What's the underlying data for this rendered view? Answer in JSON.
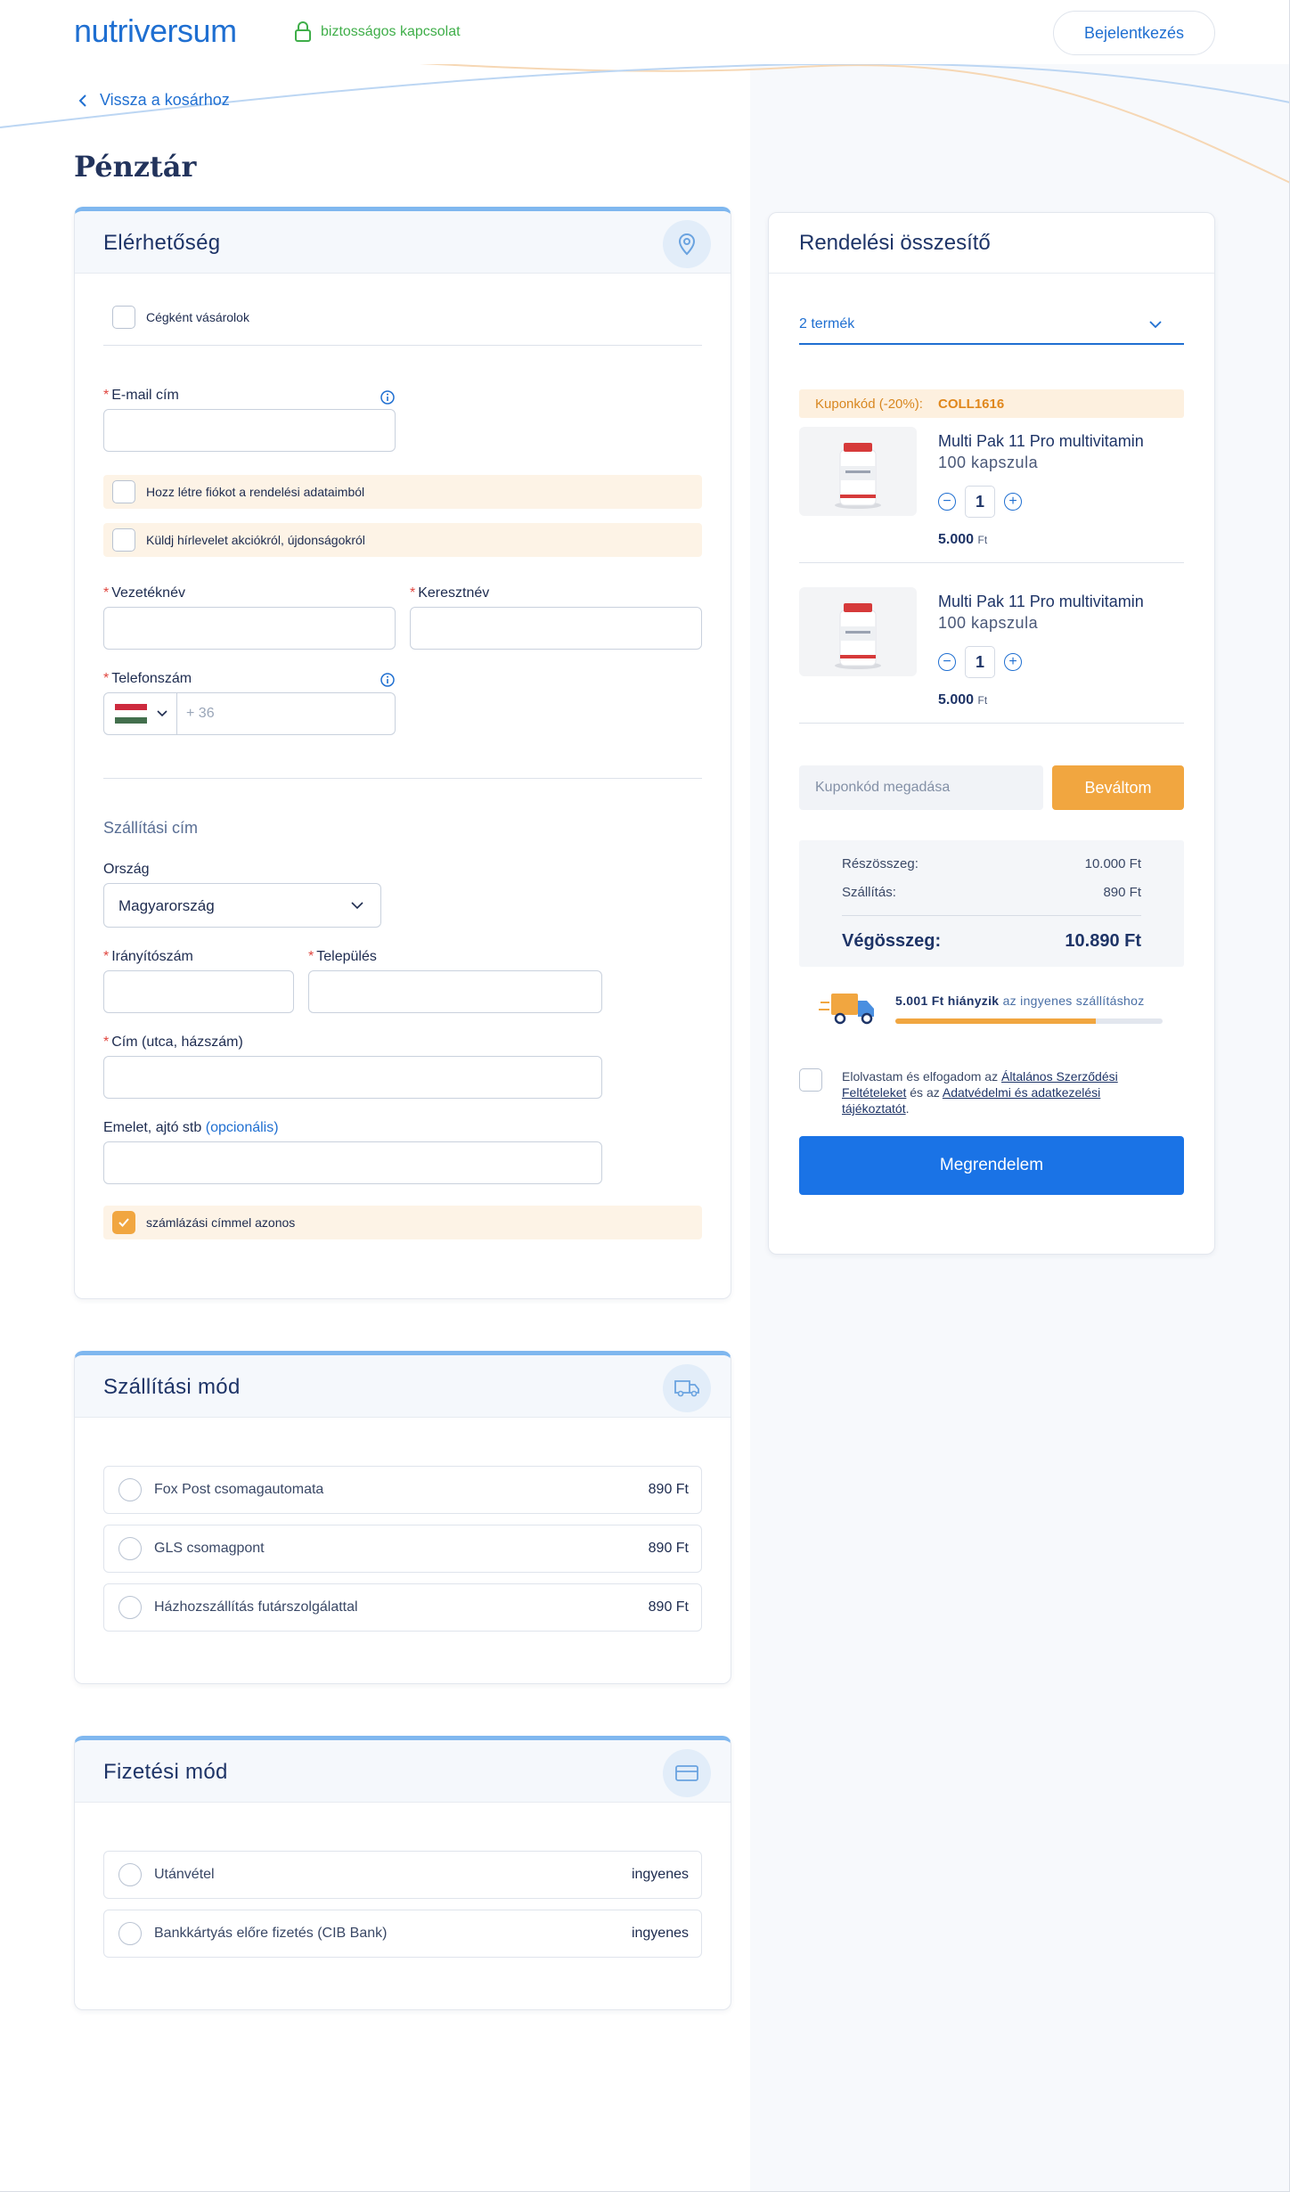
{
  "header": {
    "logo": "nutriversum",
    "secure_text": "biztosságos kapcsolat",
    "login_label": "Bejelentkezés"
  },
  "nav": {
    "back_label": "Vissza a kosárhoz"
  },
  "page_title": "Pénztár",
  "contact": {
    "title": "Elérhetőség",
    "company_checkbox": "Cégként vásárolok",
    "email_label": "E-mail cím",
    "create_account": "Hozz létre fiókot a rendelési adataimból",
    "newsletter": "Küldj hírlevelet akciókról, újdonságokról",
    "lastname_label": "Vezetéknév",
    "firstname_label": "Keresztnév",
    "phone_label": "Telefonszám",
    "phone_placeholder": "+ 36",
    "shipping_title": "Szállítási cím",
    "country_label": "Ország",
    "country_value": "Magyarország",
    "zip_label": "Irányítószám",
    "city_label": "Település",
    "address_label": "Cím (utca, házszám)",
    "floor_label": "Emelet, ajtó stb",
    "floor_optional": "(opcionális)",
    "same_billing": "számlázási címmel azonos"
  },
  "shipping": {
    "title": "Szállítási mód",
    "options": [
      {
        "label": "Fox Post csomagautomata",
        "price": "890 Ft"
      },
      {
        "label": "GLS csomagpont",
        "price": "890 Ft"
      },
      {
        "label": "Házhozszállítás futárszolgálattal",
        "price": "890 Ft"
      }
    ]
  },
  "payment": {
    "title": "Fizetési mód",
    "options": [
      {
        "label": "Utánvétel",
        "price": "ingyenes"
      },
      {
        "label": "Bankkártyás előre fizetés (CIB Bank)",
        "price": "ingyenes"
      }
    ]
  },
  "summary": {
    "title": "Rendelési összesítő",
    "items_count": "2 termék",
    "coupon_prefix": "Kuponkód (-20%):",
    "coupon_code": "COLL1616",
    "items": [
      {
        "name": "Multi Pak 11 Pro multivitamin",
        "sub": "100 kapszula",
        "qty": "1",
        "price": "5.000",
        "currency": "Ft"
      },
      {
        "name": "Multi Pak 11 Pro multivitamin",
        "sub": "100 kapszula",
        "qty": "1",
        "price": "5.000",
        "currency": "Ft"
      }
    ],
    "coupon_placeholder": "Kuponkód megadása",
    "redeem_label": "Beváltom",
    "subtotal_label": "Részösszeg:",
    "subtotal_value": "10.000 Ft",
    "shipping_label": "Szállítás:",
    "shipping_value": "890 Ft",
    "total_label": "Végösszeg:",
    "total_value": "10.890 Ft",
    "free_ship_amount": "5.001 Ft hiányzik",
    "free_ship_text": "az ingyenes szállításhoz",
    "free_ship_progress": 0.75,
    "terms_pre": "Elolvastam és elfogadom az",
    "terms_link1": "Általános Szerződési Feltételeket",
    "terms_mid": "és az",
    "terms_link2": "Adatvédelmi és adatkezelési tájékoztatót",
    "terms_end": ".",
    "order_label": "Megrendelem"
  },
  "colors": {
    "primary": "#1f6fd1",
    "accent_orange": "#f1a640",
    "secure_green": "#3fae49",
    "peach_bg": "#fdf3e6"
  }
}
